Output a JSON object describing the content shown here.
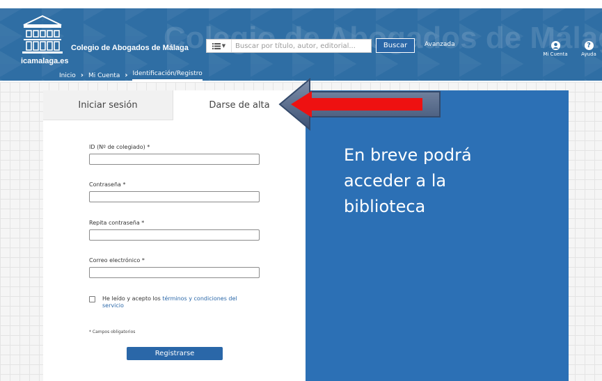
{
  "header": {
    "watermark": "Colegio de Abogados de Málaga",
    "logo_caption": "icamalaga.es",
    "site_title": "Colegio de Abogados de Málaga",
    "search": {
      "type_icon": "list-icon",
      "placeholder": "Buscar por título, autor, editorial...",
      "button_label": "Buscar"
    },
    "advanced_label": "Avanzada",
    "account": {
      "icon": "user-icon",
      "label": "Mi Cuenta"
    },
    "help": {
      "icon": "question-icon",
      "label": "Ayuda"
    }
  },
  "breadcrumb": [
    "Inicio",
    "Mi Cuenta",
    "Identificación/Registro"
  ],
  "tabs": [
    {
      "label": "Iniciar sesión",
      "active": false
    },
    {
      "label": "Darse de alta",
      "active": true
    }
  ],
  "form": {
    "fields": [
      {
        "label": "ID (Nº de colegiado) *",
        "value": ""
      },
      {
        "label": "Contraseña *",
        "value": ""
      },
      {
        "label": "Repita contraseña *",
        "value": ""
      },
      {
        "label": "Correo electrónico *",
        "value": ""
      }
    ],
    "terms_prefix": "He leído y acepto los",
    "terms_link": "términos y condiciones del servicio",
    "terms_checked": false,
    "required_note": "* Campos obligatorios",
    "submit_label": "Registrarse"
  },
  "panel": {
    "message": "En breve podrá acceder a la biblioteca"
  },
  "colors": {
    "header_blue": "#2f6ea4",
    "panel_blue": "#2c70b5",
    "button_blue": "#2a67a8",
    "arrow_red": "#ee1111"
  }
}
